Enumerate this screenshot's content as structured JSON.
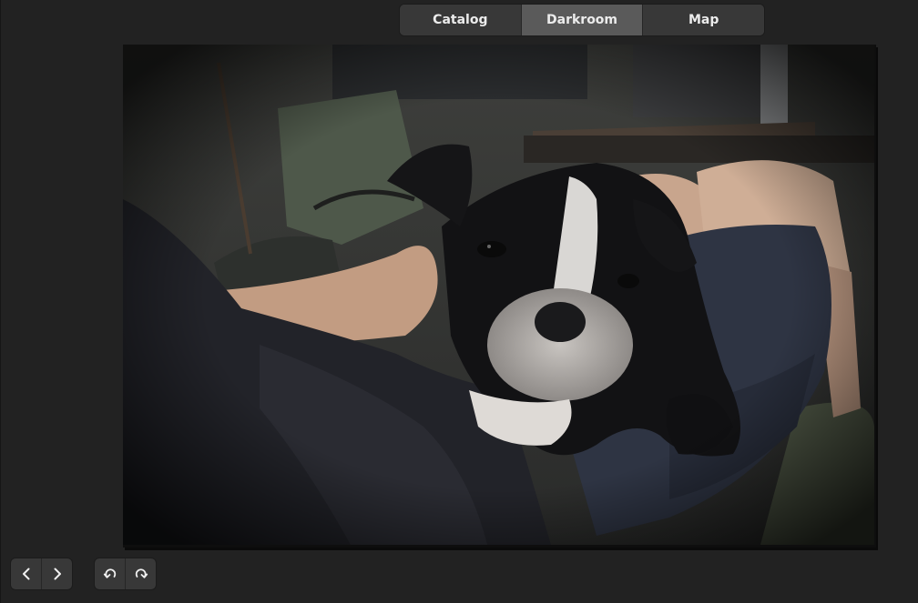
{
  "views": {
    "tabs": [
      {
        "label": "Catalog"
      },
      {
        "label": "Darkroom"
      },
      {
        "label": "Map"
      }
    ],
    "active": "Darkroom"
  },
  "photo": {
    "subject": "dog-photo"
  },
  "toolbar": {
    "previous_icon": "chevron-left-icon",
    "next_icon": "chevron-right-icon",
    "undo_icon": "undo-icon",
    "redo_icon": "redo-icon"
  },
  "colors": {
    "background": "#222222",
    "button": "#383838",
    "button_active": "#5a5a5a",
    "text": "#ececec"
  }
}
